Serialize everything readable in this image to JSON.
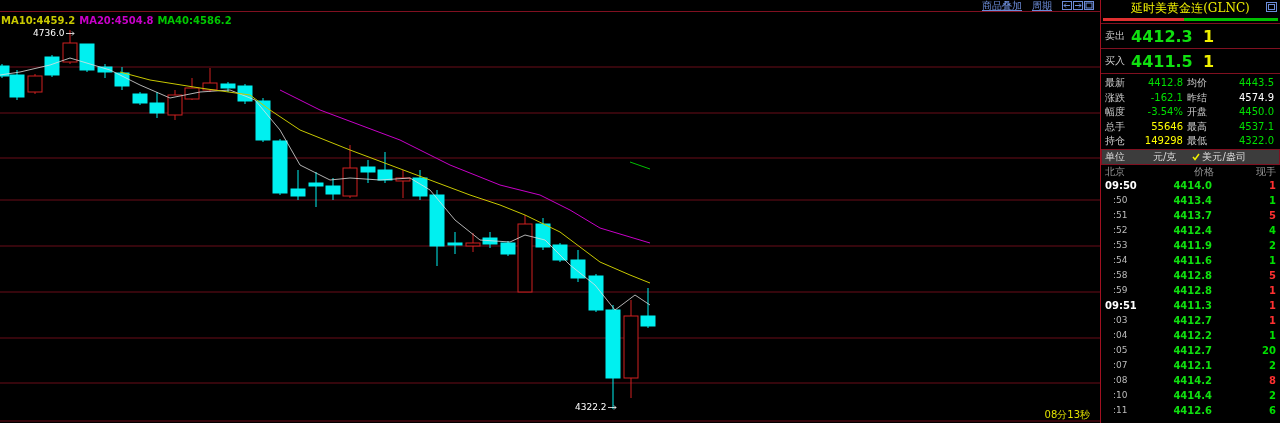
{
  "chart": {
    "legend": [
      {
        "label": "MA10:4459.2",
        "color": "#c8c800"
      },
      {
        "label": "MA20:4504.8",
        "color": "#c800c8"
      },
      {
        "label": "MA40:4586.2",
        "color": "#00c800"
      }
    ],
    "high_label": "4736.0",
    "low_label": "4322.2",
    "timer": "08分13秒"
  },
  "toolbar": {
    "links": [
      "商品叠加",
      "周期"
    ]
  },
  "quote": {
    "title": "延时美黄金连(GLNC)",
    "ratio_bar": {
      "level": 0.46
    },
    "book": [
      {
        "label": "卖出",
        "price": "4412.3",
        "volume": "1"
      },
      {
        "label": "买入",
        "price": "4411.5",
        "volume": "1"
      }
    ],
    "stats": [
      [
        {
          "label": "最新",
          "value": "4412.8",
          "color": "#00e000"
        },
        {
          "label": "均价",
          "value": "4443.5",
          "color": "#00e000"
        }
      ],
      [
        {
          "label": "涨跌",
          "value": "-162.1",
          "color": "#00e000"
        },
        {
          "label": "昨结",
          "value": "4574.9",
          "color": "#ffffff"
        }
      ],
      [
        {
          "label": "幅度",
          "value": "-3.54%",
          "color": "#00e000"
        },
        {
          "label": "开盘",
          "value": "4450.0",
          "color": "#00e000"
        }
      ],
      [
        {
          "label": "总手",
          "value": "55646",
          "color": "#ffff00"
        },
        {
          "label": "最高",
          "value": "4537.1",
          "color": "#00e000"
        }
      ],
      [
        {
          "label": "持仓",
          "value": "149298",
          "color": "#ffff00"
        },
        {
          "label": "最低",
          "value": "4322.0",
          "color": "#00e000"
        }
      ]
    ],
    "unit": {
      "label": "单位",
      "options": [
        {
          "label": "元/克",
          "selected": false
        },
        {
          "label": "美元/盎司",
          "selected": true
        }
      ]
    },
    "ticks": {
      "columns": [
        "北京",
        "价格",
        "现手"
      ],
      "rows": [
        {
          "time": "09:50",
          "kind": "full",
          "price": "4414.0",
          "volume": "1",
          "color": "#ff3030"
        },
        {
          "time": ":50",
          "kind": "short",
          "price": "4413.4",
          "volume": "1",
          "color": "#00e000"
        },
        {
          "time": ":51",
          "kind": "short",
          "price": "4413.7",
          "volume": "5",
          "color": "#ff3030"
        },
        {
          "time": ":52",
          "kind": "short",
          "price": "4412.4",
          "volume": "4",
          "color": "#00e000"
        },
        {
          "time": ":53",
          "kind": "short",
          "price": "4411.9",
          "volume": "2",
          "color": "#00e000"
        },
        {
          "time": ":54",
          "kind": "short",
          "price": "4411.6",
          "volume": "1",
          "color": "#00e000"
        },
        {
          "time": ":58",
          "kind": "short",
          "price": "4412.8",
          "volume": "5",
          "color": "#ff3030"
        },
        {
          "time": ":59",
          "kind": "short",
          "price": "4412.8",
          "volume": "1",
          "color": "#ff3030"
        },
        {
          "time": "09:51",
          "kind": "full",
          "price": "4411.3",
          "volume": "1",
          "color": "#ff3030"
        },
        {
          "time": ":03",
          "kind": "short",
          "price": "4412.7",
          "volume": "1",
          "color": "#ff3030"
        },
        {
          "time": ":04",
          "kind": "short",
          "price": "4412.2",
          "volume": "1",
          "color": "#00e000"
        },
        {
          "time": ":05",
          "kind": "short",
          "price": "4412.7",
          "volume": "20",
          "color": "#00e000"
        },
        {
          "time": ":07",
          "kind": "short",
          "price": "4412.1",
          "volume": "2",
          "color": "#00e000"
        },
        {
          "time": ":08",
          "kind": "short",
          "price": "4414.2",
          "volume": "8",
          "color": "#ff3030"
        },
        {
          "time": ":10",
          "kind": "short",
          "price": "4414.4",
          "volume": "2",
          "color": "#00e000"
        },
        {
          "time": ":11",
          "kind": "short",
          "price": "4412.6",
          "volume": "6",
          "color": "#00e000"
        }
      ]
    }
  }
}
